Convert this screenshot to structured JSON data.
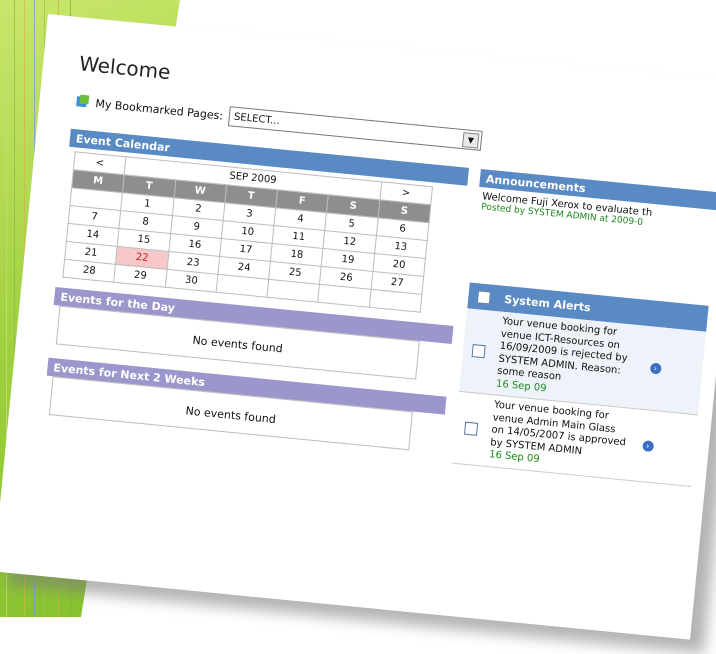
{
  "page": {
    "title": "Welcome"
  },
  "bookmarks": {
    "label": "My Bookmarked Pages:",
    "selected": "SELECT..."
  },
  "calendar": {
    "header": "Event Calendar",
    "prev": "<",
    "next": ">",
    "month": "SEP 2009",
    "days": [
      "M",
      "T",
      "W",
      "T",
      "F",
      "S",
      "S"
    ],
    "weeks": [
      [
        "",
        "1",
        "2",
        "3",
        "4",
        "5",
        "6"
      ],
      [
        "7",
        "8",
        "9",
        "10",
        "11",
        "12",
        "13"
      ],
      [
        "14",
        "15",
        "16",
        "17",
        "18",
        "19",
        "20"
      ],
      [
        "21",
        "22",
        "23",
        "24",
        "25",
        "26",
        "27"
      ],
      [
        "28",
        "29",
        "30",
        "",
        "",
        "",
        ""
      ]
    ],
    "today": "22"
  },
  "events_today": {
    "header": "Events for the Day",
    "empty": "No events found"
  },
  "events_next": {
    "header": "Events for Next 2 Weeks",
    "empty": "No events found"
  },
  "announcements": {
    "header": "Announcements",
    "text": "Welcome Fuji Xerox to evaluate th",
    "meta": "Posted by SYSTEM ADMIN at 2009-0"
  },
  "alerts": {
    "header": "System Alerts",
    "items": [
      {
        "text": "Your venue booking for venue ICT-Resources on 16/09/2009 is rejected by SYSTEM ADMIN. Reason: some reason",
        "date": "16 Sep 09"
      },
      {
        "text": "Your venue booking for venue Admin Main Glass on 14/05/2007 is approved by SYSTEM ADMIN",
        "date": "16 Sep 09"
      }
    ]
  },
  "colors": {
    "bar_blue": "#5a8ac4",
    "bar_purple": "#9b96cc",
    "green": "#9ccf3c"
  }
}
